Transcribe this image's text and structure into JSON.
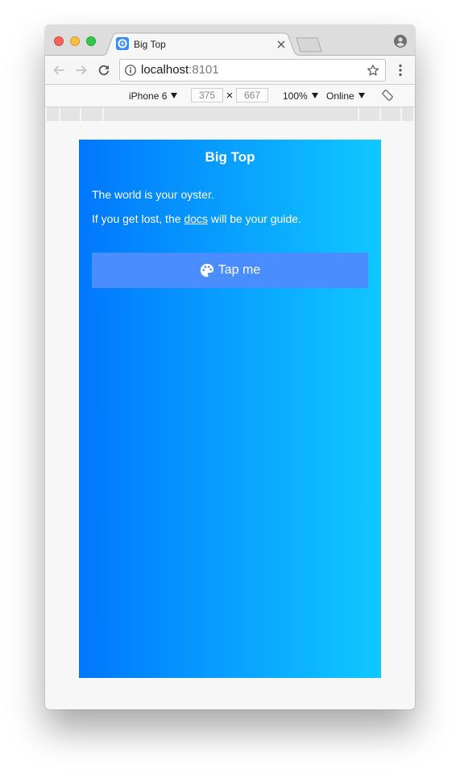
{
  "browser": {
    "tab": {
      "title": "Big Top",
      "favicon_icon": "app-favicon-icon",
      "close_icon": "close-icon"
    },
    "new_tab_icon": "new-tab-icon",
    "profile_icon": "profile-icon",
    "navigation": {
      "back_icon": "back-arrow-icon",
      "forward_icon": "forward-arrow-icon",
      "reload_icon": "reload-icon"
    },
    "omnibox": {
      "security_icon": "info-icon",
      "host": "localhost",
      "port": ":8101",
      "bookmark_icon": "star-icon"
    },
    "menu_icon": "kebab-menu-icon"
  },
  "device_toolbar": {
    "device": "iPhone 6",
    "width": "375",
    "dimension_separator": "×",
    "height": "667",
    "zoom": "100%",
    "network": "Online",
    "dropdown_icon": "dropdown-arrow-icon",
    "rotate_icon": "rotate-icon"
  },
  "app": {
    "title": "Big Top",
    "intro": "The world is your oyster.",
    "guide_before": "If you get lost, the ",
    "guide_link": "docs",
    "guide_after": " will be your guide.",
    "button": {
      "label": "Tap me",
      "icon": "palette-icon"
    }
  },
  "colors": {
    "app_gradient_start": "#0077ff",
    "app_gradient_end": "#10c8ff",
    "button_background": "#4a8dff",
    "favicon": "#3b8bf5",
    "window_close": "#fc605c",
    "window_minimize": "#fdbc40",
    "window_zoom": "#34c84a"
  }
}
